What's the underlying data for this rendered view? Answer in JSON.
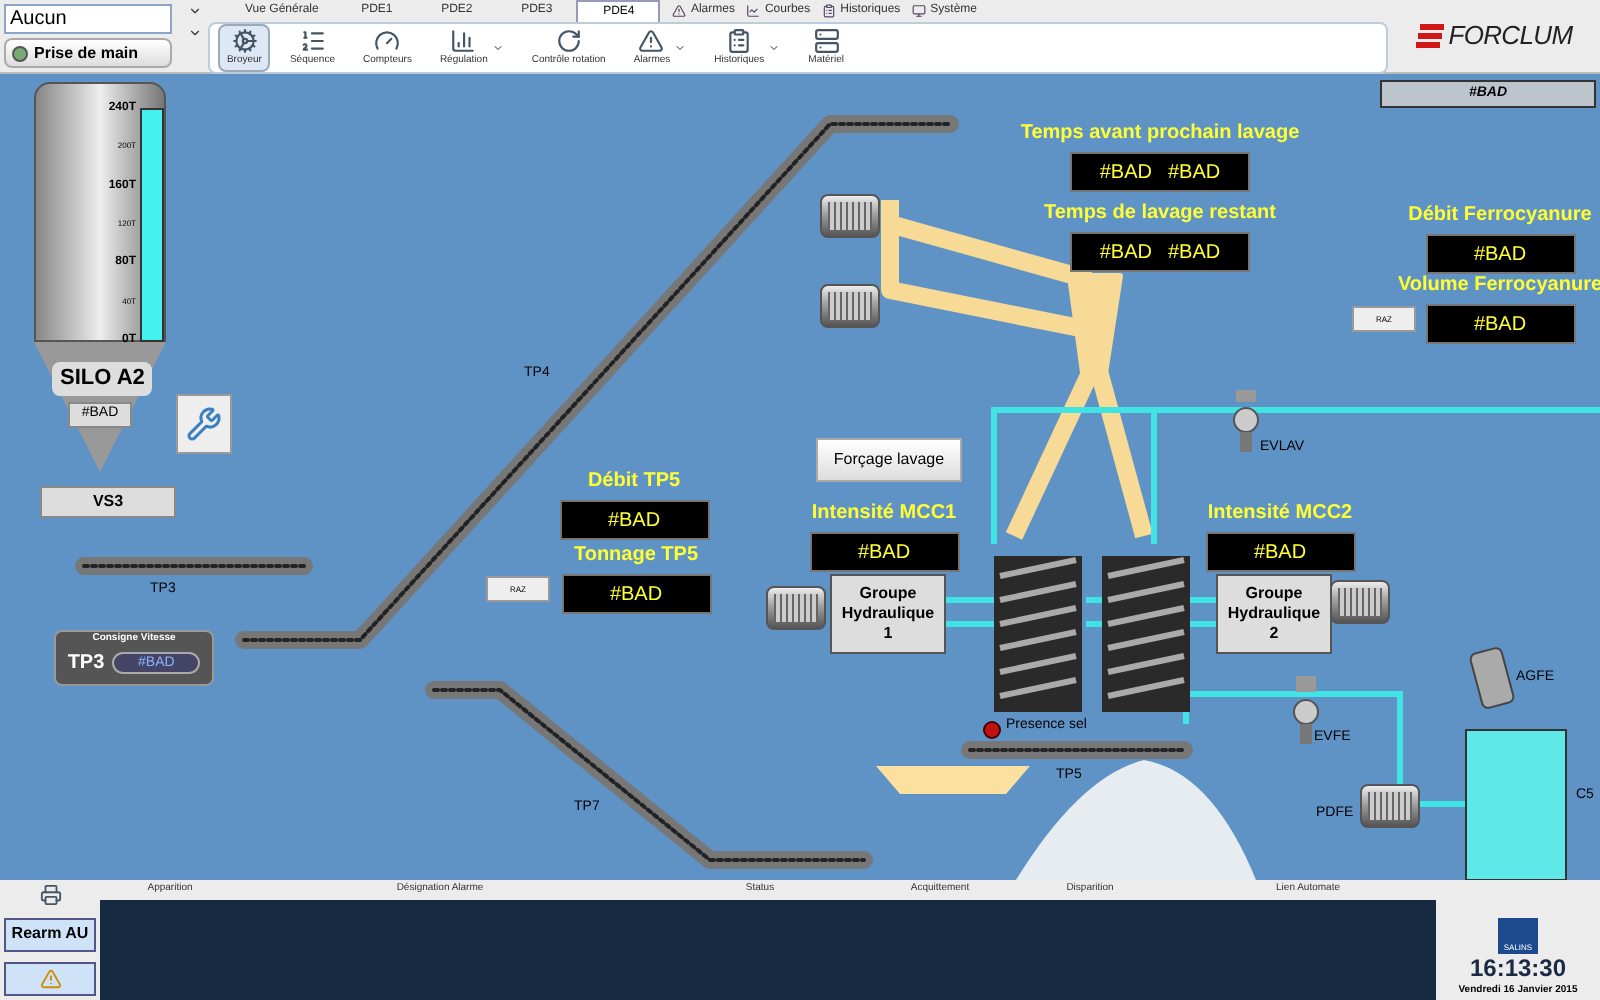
{
  "header": {
    "user_field": {
      "value": "Aucun"
    },
    "take_control_button": "Prise de main",
    "tabs": [
      {
        "label": "Vue Générale",
        "selected": false
      },
      {
        "label": "PDE1",
        "selected": false
      },
      {
        "label": "PDE2",
        "selected": false
      },
      {
        "label": "PDE3",
        "selected": false
      },
      {
        "label": "PDE4",
        "selected": true
      }
    ],
    "links": [
      "Alarmes",
      "Courbes",
      "Historiques",
      "Système"
    ],
    "toolbar": [
      {
        "label": "Broyeur",
        "selected": true,
        "dropdown": false
      },
      {
        "label": "Séquence",
        "selected": false,
        "dropdown": false
      },
      {
        "label": "Compteurs",
        "selected": false,
        "dropdown": false
      },
      {
        "label": "Régulation",
        "selected": false,
        "dropdown": true
      },
      {
        "label": "Contrôle rotation",
        "selected": false,
        "dropdown": false
      },
      {
        "label": "Alarmes",
        "selected": false,
        "dropdown": true
      },
      {
        "label": "Historiques",
        "selected": false,
        "dropdown": true
      },
      {
        "label": "Matériel",
        "selected": false,
        "dropdown": false
      }
    ],
    "logo": "FORCLUM"
  },
  "synoptic": {
    "status_field": "#BAD",
    "silo": {
      "name": "SILO A2",
      "value": "#BAD",
      "level": 1,
      "ticks": [
        "240T",
        "200T",
        "160T",
        "120T",
        "80T",
        "40T",
        "0T"
      ]
    },
    "feeder": "VS3",
    "conveyors": [
      {
        "label": "TP3"
      },
      {
        "label": "TP4"
      },
      {
        "label": "TP5"
      },
      {
        "label": "TP7"
      }
    ],
    "speed_setpoint": {
      "title": "Consigne Vitesse",
      "label": "TP3",
      "value": "#BAD"
    },
    "readouts": [
      {
        "label": "Débit TP5",
        "values": [
          "#BAD"
        ]
      },
      {
        "label": "Tonnage TP5",
        "values": [
          "#BAD"
        ],
        "reset_button": "RAZ"
      },
      {
        "label": "Temps avant prochain lavage",
        "values": [
          "#BAD",
          "#BAD"
        ]
      },
      {
        "label": "Temps de lavage restant",
        "values": [
          "#BAD",
          "#BAD"
        ]
      },
      {
        "label": "Débit Ferrocyanure",
        "values": [
          "#BAD"
        ]
      },
      {
        "label": "Volume Ferrocyanure",
        "values": [
          "#BAD"
        ],
        "reset_button": "RAZ"
      },
      {
        "label": "Intensité MCC1",
        "values": [
          "#BAD"
        ]
      },
      {
        "label": "Intensité MCC2",
        "values": [
          "#BAD"
        ]
      }
    ],
    "wash_button": "Forçage lavage",
    "hydraulic_units": [
      "Groupe Hydraulique 1",
      "Groupe Hydraulique 2"
    ],
    "equipment_labels": [
      "EVLAV",
      "EVFE",
      "AGFE",
      "PDFE",
      "C5"
    ],
    "presence_label": "Presence sel"
  },
  "alarm_panel": {
    "rearm_button": "Rearm AU",
    "columns": [
      "Apparition",
      "Désignation Alarme",
      "Status",
      "Acquittement",
      "Disparition",
      "Lien Automate"
    ]
  },
  "clock": {
    "logo": "SALINS",
    "time": "16:13:30",
    "date": "Vendredi 16 Janvier 2015"
  }
}
